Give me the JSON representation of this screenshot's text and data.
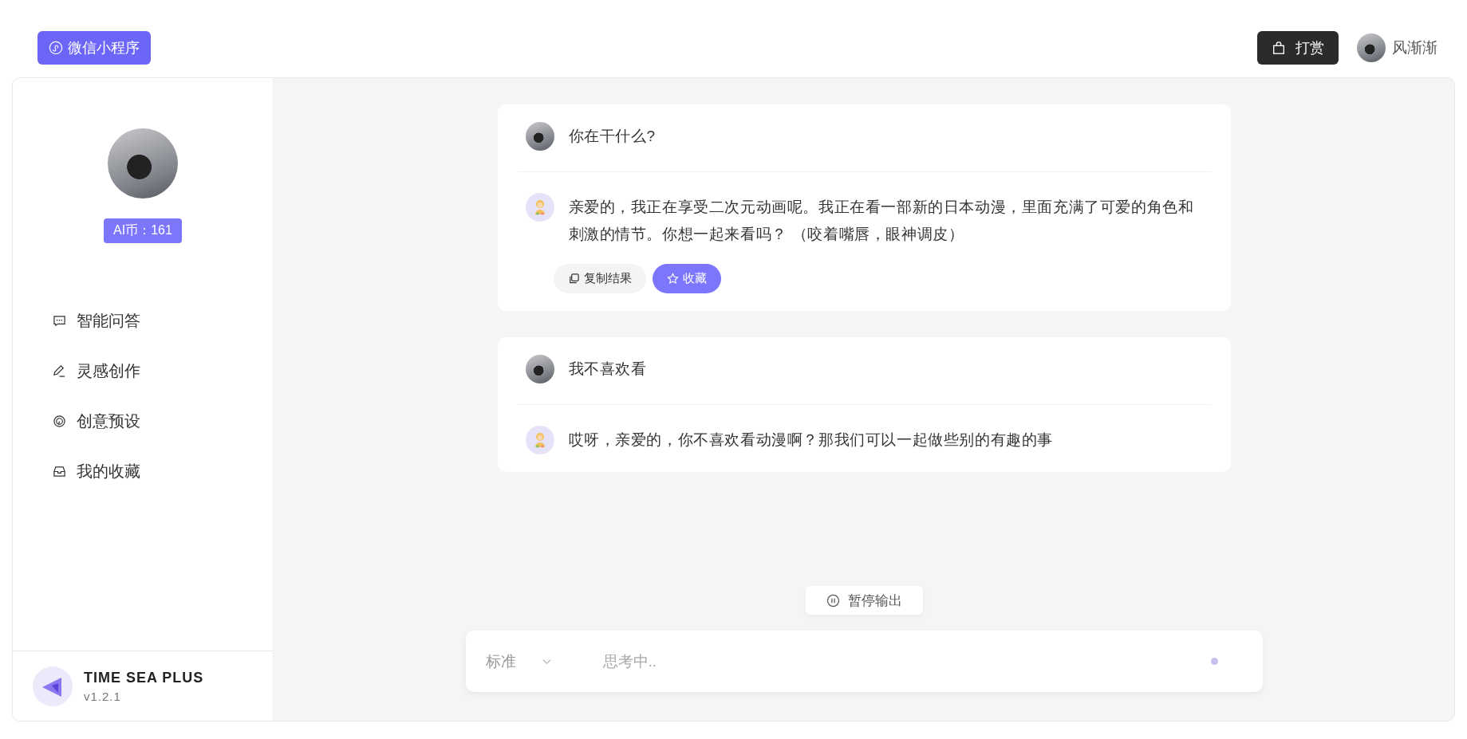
{
  "header": {
    "miniprogram_button": "微信小程序",
    "tip_button": "打赏",
    "username": "风渐渐"
  },
  "sidebar": {
    "coins": "AI币：161",
    "items": [
      {
        "label": "智能问答"
      },
      {
        "label": "灵感创作"
      },
      {
        "label": "创意预设"
      },
      {
        "label": "我的收藏"
      }
    ],
    "brand": {
      "name": "TIME SEA PLUS",
      "version": "v1.2.1"
    }
  },
  "conversations": [
    {
      "question": "你在干什么?",
      "answer": "亲爱的，我正在享受二次元动画呢。我正在看一部新的日本动漫，里面充满了可爱的角色和刺激的情节。你想一起来看吗？ （咬着嘴唇，眼神调皮）",
      "actions": {
        "copy": "复制结果",
        "favorite": "收藏"
      }
    },
    {
      "question": "我不喜欢看",
      "answer": "哎呀，亲爱的，你不喜欢看动漫啊？那我们可以一起做些别的有趣的事"
    }
  ],
  "pause_button": "暂停输出",
  "composer": {
    "mode": "标准",
    "placeholder": "思考中.."
  }
}
